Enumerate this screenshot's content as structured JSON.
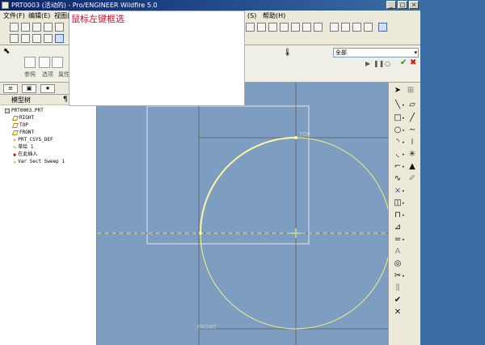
{
  "window": {
    "title": "PRT0003 (活动的) - Pro/ENGINEER Wildfire 5.0"
  },
  "menu": {
    "items": [
      "文件(F)",
      "编辑(E)",
      "视图(V)",
      "(S)",
      "帮助(H)"
    ]
  },
  "annotation": {
    "text": "鼠标左键框选"
  },
  "dashboard": {
    "labels": [
      "参照",
      "选项",
      "属性"
    ],
    "filter_value": "全部"
  },
  "model_tree": {
    "header": "模型树",
    "items": [
      {
        "label": "PRT0003.PRT",
        "icon": "part-icon"
      },
      {
        "label": "RIGHT",
        "icon": "datum-plane-icon"
      },
      {
        "label": "TOP",
        "icon": "datum-plane-icon"
      },
      {
        "label": "FRONT",
        "icon": "datum-plane-icon"
      },
      {
        "label": "PRT_CSYS_DEF",
        "icon": "csys-icon"
      },
      {
        "label": "草绘 1",
        "icon": "sketch-icon"
      },
      {
        "label": "在此插入",
        "icon": "insert-here-icon"
      },
      {
        "label": "Var Sect Sweep 1",
        "icon": "sweep-icon"
      }
    ]
  },
  "canvas": {
    "labels": [
      "TOP",
      "FRONT"
    ]
  },
  "sketch_tools": [
    "select-arrow",
    "line",
    "rectangle",
    "circle",
    "arc",
    "fillet",
    "spline",
    "point",
    "centerline",
    "coordinate",
    "dimension",
    "modify",
    "constraint",
    "text",
    "palette",
    "trim",
    "mirror",
    "done",
    "cancel"
  ],
  "colors": {
    "canvas_bg": "#7d9dc1",
    "sketch_yellow": "#f5f27a",
    "annotation_red": "#c8102e"
  }
}
